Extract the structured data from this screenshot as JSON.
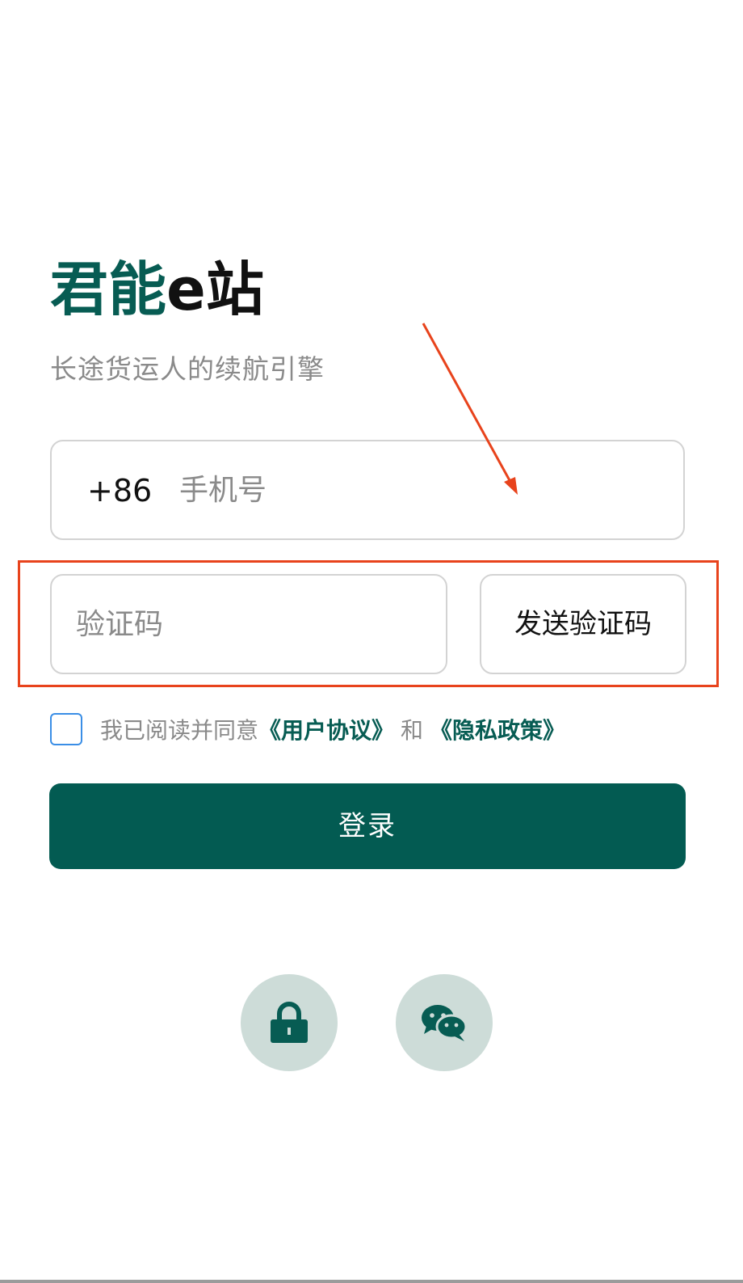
{
  "brand": {
    "name_part1": "君能",
    "name_part2": "e站",
    "slogan": "长途货运人的续航引擎"
  },
  "phone": {
    "prefix": "+86",
    "placeholder": "手机号"
  },
  "code": {
    "placeholder": "验证码",
    "send_label": "发送验证码"
  },
  "agreement": {
    "checked": false,
    "text": "我已阅读并同意",
    "user_agreement": "《用户协议》",
    "and": "和",
    "privacy_policy": "《隐私政策》"
  },
  "login": {
    "label": "登录"
  },
  "alt_login": [
    {
      "icon": "lock-icon"
    },
    {
      "icon": "wechat-icon"
    }
  ],
  "colors": {
    "brand_green": "#075c53",
    "button_green": "#035b52",
    "circle_bg": "#cddcd8",
    "annotation_red": "#e8431c",
    "checkbox_blue": "#3a8ee6"
  }
}
